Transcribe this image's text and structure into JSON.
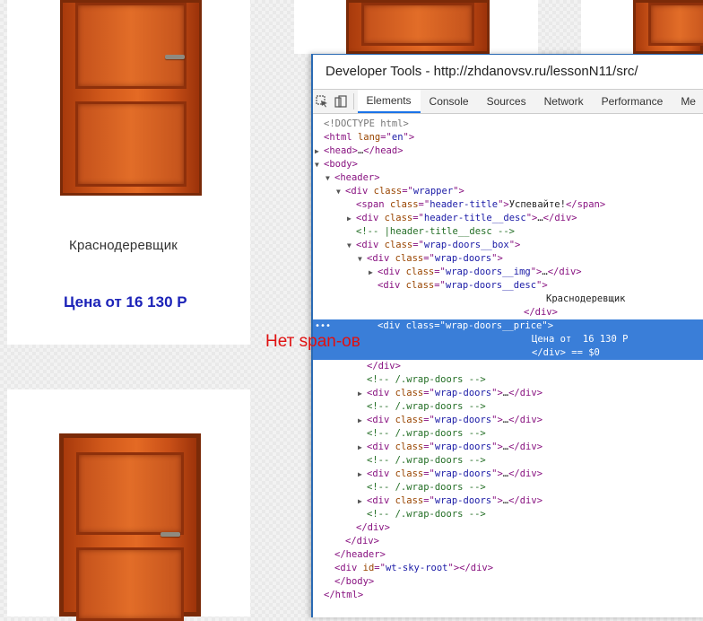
{
  "page": {
    "card1": {
      "title": "Краснодеревщик",
      "price": "Цена от 16 130 Р"
    },
    "annotation": "Нет span-ов"
  },
  "devtools": {
    "title": "Developer Tools - http://zhdanovsv.ru/lessonN11/src/",
    "tabs": [
      "Elements",
      "Console",
      "Sources",
      "Network",
      "Performance",
      "Me"
    ],
    "active_tab": "Elements",
    "selected_suffix": "== $0",
    "lines": [
      {
        "indent": 0,
        "tri": "",
        "html": "<!DOCTYPE html>",
        "kind": "doctype"
      },
      {
        "indent": 0,
        "tri": "",
        "open": "html",
        "attrs": [
          [
            "lang",
            "en"
          ]
        ],
        "kind": "open"
      },
      {
        "indent": 0,
        "tri": "▶",
        "open": "head",
        "collapsed": "head",
        "kind": "collapsed"
      },
      {
        "indent": 0,
        "tri": "▼",
        "open": "body",
        "kind": "open"
      },
      {
        "indent": 1,
        "tri": "▼",
        "open": "header",
        "kind": "open"
      },
      {
        "indent": 2,
        "tri": "▼",
        "open": "div",
        "attrs": [
          [
            "class",
            "wrapper"
          ]
        ],
        "kind": "open"
      },
      {
        "indent": 3,
        "tri": "",
        "open": "span",
        "attrs": [
          [
            "class",
            "header-title"
          ]
        ],
        "text": "Успевайте!",
        "close": "span",
        "kind": "inline"
      },
      {
        "indent": 3,
        "tri": "▶",
        "open": "div",
        "attrs": [
          [
            "class",
            "header-title__desc"
          ]
        ],
        "collapsed": "div",
        "kind": "collapsed"
      },
      {
        "indent": 3,
        "tri": "",
        "comment": "<!-- |header-title__desc -->",
        "kind": "comment"
      },
      {
        "indent": 3,
        "tri": "▼",
        "open": "div",
        "attrs": [
          [
            "class",
            "wrap-doors__box"
          ]
        ],
        "kind": "open"
      },
      {
        "indent": 4,
        "tri": "▼",
        "open": "div",
        "attrs": [
          [
            "class",
            "wrap-doors"
          ]
        ],
        "kind": "open"
      },
      {
        "indent": 5,
        "tri": "▶",
        "open": "div",
        "attrs": [
          [
            "class",
            "wrap-doors__img"
          ]
        ],
        "collapsed": "div",
        "kind": "collapsed"
      },
      {
        "indent": 5,
        "tri": "",
        "open": "div",
        "attrs": [
          [
            "class",
            "wrap-doors__desc"
          ]
        ],
        "kind": "open"
      },
      {
        "indent": 0,
        "tri": "",
        "text": "Краснодеревщик",
        "kind": "text",
        "pad": 260
      },
      {
        "indent": 6,
        "tri": "",
        "endtag": "div",
        "kind": "end",
        "pad": 235
      },
      {
        "indent": 5,
        "tri": "",
        "open": "div",
        "attrs": [
          [
            "class",
            "wrap-doors__price"
          ]
        ],
        "kind": "open",
        "selected": true
      },
      {
        "indent": 0,
        "tri": "",
        "text": "Цена от  16 130 Р",
        "kind": "text",
        "pad": 244,
        "selected": true
      },
      {
        "indent": 0,
        "tri": "",
        "endtag": "div",
        "kind": "end",
        "pad": 244,
        "selected": true,
        "suffix": true
      },
      {
        "indent": 4,
        "tri": "",
        "endtag": "div",
        "kind": "end"
      },
      {
        "indent": 4,
        "tri": "",
        "comment": "<!-- /.wrap-doors -->",
        "kind": "comment"
      },
      {
        "indent": 4,
        "tri": "▶",
        "open": "div",
        "attrs": [
          [
            "class",
            "wrap-doors"
          ]
        ],
        "collapsed": "div",
        "kind": "collapsed"
      },
      {
        "indent": 4,
        "tri": "",
        "comment": "<!-- /.wrap-doors -->",
        "kind": "comment"
      },
      {
        "indent": 4,
        "tri": "▶",
        "open": "div",
        "attrs": [
          [
            "class",
            "wrap-doors"
          ]
        ],
        "collapsed": "div",
        "kind": "collapsed"
      },
      {
        "indent": 4,
        "tri": "",
        "comment": "<!-- /.wrap-doors -->",
        "kind": "comment"
      },
      {
        "indent": 4,
        "tri": "▶",
        "open": "div",
        "attrs": [
          [
            "class",
            "wrap-doors"
          ]
        ],
        "collapsed": "div",
        "kind": "collapsed"
      },
      {
        "indent": 4,
        "tri": "",
        "comment": "<!-- /.wrap-doors -->",
        "kind": "comment"
      },
      {
        "indent": 4,
        "tri": "▶",
        "open": "div",
        "attrs": [
          [
            "class",
            "wrap-doors"
          ]
        ],
        "collapsed": "div",
        "kind": "collapsed"
      },
      {
        "indent": 4,
        "tri": "",
        "comment": "<!-- /.wrap-doors -->",
        "kind": "comment"
      },
      {
        "indent": 4,
        "tri": "▶",
        "open": "div",
        "attrs": [
          [
            "class",
            "wrap-doors"
          ]
        ],
        "collapsed": "div",
        "kind": "collapsed"
      },
      {
        "indent": 4,
        "tri": "",
        "comment": "<!-- /.wrap-doors -->",
        "kind": "comment"
      },
      {
        "indent": 3,
        "tri": "",
        "endtag": "div",
        "kind": "end"
      },
      {
        "indent": 2,
        "tri": "",
        "endtag": "div",
        "kind": "end"
      },
      {
        "indent": 1,
        "tri": "",
        "endtag": "header",
        "kind": "end"
      },
      {
        "indent": 1,
        "tri": "",
        "open": "div",
        "attrs": [
          [
            "id",
            "wt-sky-root"
          ]
        ],
        "text": "",
        "close": "div",
        "kind": "inline"
      },
      {
        "indent": 1,
        "tri": "",
        "endtag": "body",
        "kind": "end"
      },
      {
        "indent": 0,
        "tri": "",
        "endtag": "html",
        "kind": "end"
      }
    ]
  }
}
